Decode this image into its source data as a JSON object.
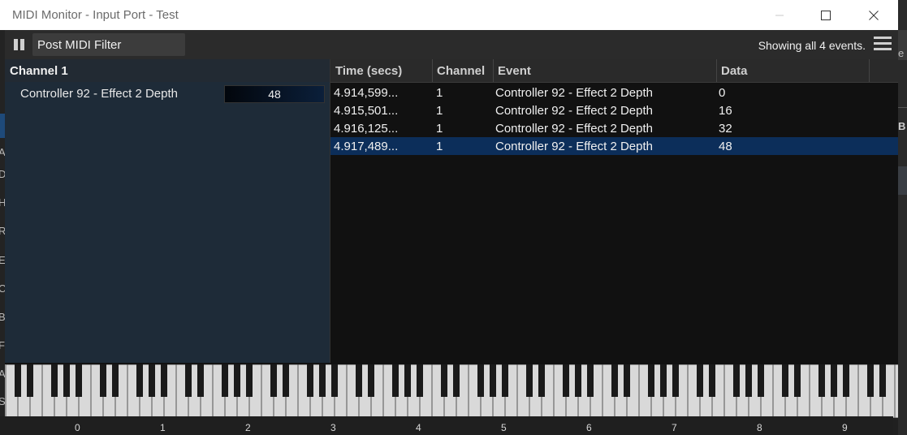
{
  "window": {
    "title": "MIDI Monitor - Input Port - Test",
    "minimize_icon": "minimize-icon",
    "maximize_icon": "maximize-icon",
    "close_icon": "close-icon"
  },
  "toolbar": {
    "pause_icon": "pause-icon",
    "filter_value": "Post MIDI Filter",
    "status": "Showing all 4 events.",
    "menu_icon": "hamburger-menu-icon"
  },
  "controllers": {
    "channel_label": "Channel 1",
    "items": [
      {
        "label": "Controller 92 - Effect 2 Depth",
        "value": "48"
      }
    ]
  },
  "events": {
    "columns": [
      "Time (secs)",
      "Channel",
      "Event",
      "Data"
    ],
    "rows": [
      {
        "time": "4.914,599...",
        "channel": "1",
        "event": "Controller 92 - Effect 2 Depth",
        "data": "0"
      },
      {
        "time": "4.915,501...",
        "channel": "1",
        "event": "Controller 92 - Effect 2 Depth",
        "data": "16"
      },
      {
        "time": "4.916,125...",
        "channel": "1",
        "event": "Controller 92 - Effect 2 Depth",
        "data": "32"
      },
      {
        "time": "4.917,489...",
        "channel": "1",
        "event": "Controller 92 - Effect 2 Depth",
        "data": "48",
        "selected": true
      }
    ]
  },
  "keyboard": {
    "octave_labels": [
      "0",
      "1",
      "2",
      "3",
      "4",
      "5",
      "6",
      "7",
      "8",
      "9"
    ]
  },
  "background_fragments": {
    "right": [
      "e",
      "B"
    ],
    "left": [
      "A",
      "D",
      "H",
      "R",
      "E",
      "C",
      "B",
      "F",
      "A",
      "S",
      "F"
    ]
  },
  "colors": {
    "selection": "#0c2e5a",
    "panel": "#1e2b38",
    "table_bg": "#111111"
  }
}
